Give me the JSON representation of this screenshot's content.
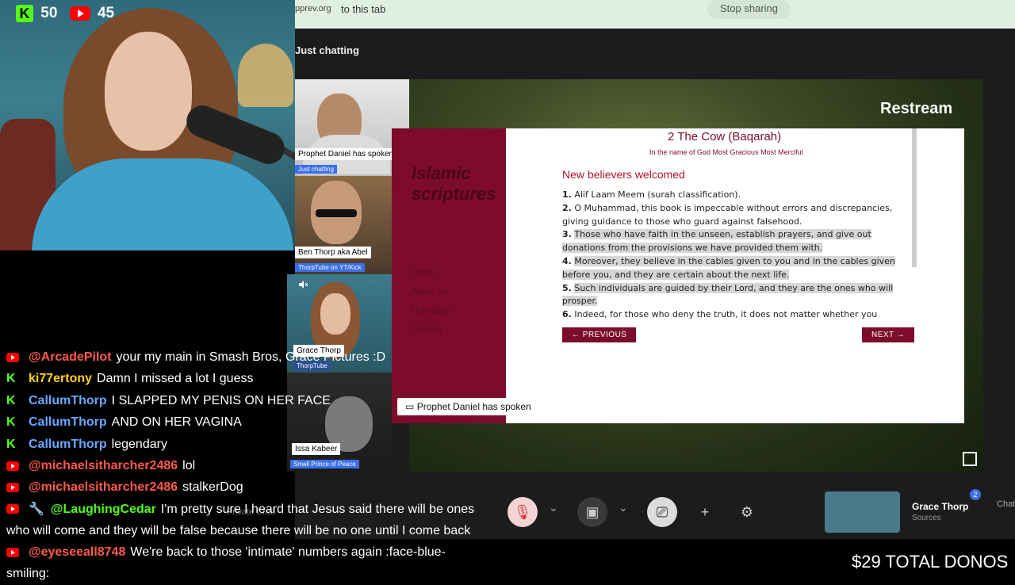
{
  "stats": {
    "kick_viewers": "50",
    "youtube_viewers": "45"
  },
  "share_bar": {
    "url_fragment": "pprev.org",
    "tab_text": "to this tab",
    "stop_label": "Stop sharing"
  },
  "studio": {
    "title": "Just chatting",
    "watermark": "Restream",
    "caption": "Prophet Daniel has spoken"
  },
  "participants": [
    {
      "name": "Prophet Daniel has spoken",
      "sub": "Just chatting"
    },
    {
      "name": "Ben Thorp aka Abel",
      "sub": "ThorpTube on YT/Kick"
    },
    {
      "name": "Grace Thorp",
      "sub": "ThorpTube"
    },
    {
      "name": "Issa Kabeer",
      "sub": "Small Prince of Peace"
    }
  ],
  "slide": {
    "brand": "Islamic scriptures",
    "nav": [
      "Home",
      "About Us",
      "Holy Bible",
      "Contact"
    ],
    "chapter_title": "2 The Cow (Baqarah)",
    "subtitle": "In the name of God Most Gracious Most Merciful",
    "heading": "New believers welcomed",
    "verses": [
      {
        "num": "1.",
        "text": "Alif Laam Meem (surah classification)."
      },
      {
        "num": "2.",
        "text": "O Muhammad, this book is impeccable without errors and discrepancies, giving guidance to those who guard against falsehood."
      },
      {
        "num": "3.",
        "text": "Those who have faith in the unseen, establish prayers, and give out donations from the provisions we have provided them with."
      },
      {
        "num": "4.",
        "text": "Moreover, they believe in the cables given to you and in the cables given before you, and they are certain about the next life."
      },
      {
        "num": "5.",
        "text": "Such individuals are guided by their Lord, and they are the ones who will prosper."
      },
      {
        "num": "6.",
        "text": "Indeed, for those who deny the truth, it does not matter whether you"
      }
    ],
    "prev_label": "← PREVIOUS",
    "next_label": "NEXT →"
  },
  "toolbar": {
    "private_chat": "Private Chat",
    "profile_name": "Grace Thorp",
    "profile_sub": "Sources",
    "badge_count": "2",
    "chat_label": "Chat"
  },
  "chat": [
    {
      "platform": "youtube",
      "user": "@ArcadePilot",
      "color": "red",
      "text": "your my main in Smash Bros, Grace Pictures :D"
    },
    {
      "platform": "kick",
      "user": "ki77ertony",
      "color": "yellow",
      "text": "Damn I missed a lot I guess"
    },
    {
      "platform": "kick",
      "user": "CallumThorp",
      "color": "blue",
      "text": "I SLAPPED MY PENIS ON HER FACE"
    },
    {
      "platform": "kick",
      "user": "CallumThorp",
      "color": "blue",
      "text": "AND ON HER VAGINA"
    },
    {
      "platform": "kick",
      "user": "CallumThorp",
      "color": "blue",
      "text": "legendary"
    },
    {
      "platform": "youtube",
      "user": "@michaelsitharcher2486",
      "color": "red",
      "text": "lol"
    },
    {
      "platform": "youtube",
      "user": "@michaelsitharcher2486",
      "color": "red",
      "text": "stalkerDog"
    },
    {
      "platform": "youtube",
      "user": "@LaughingCedar",
      "color": "green",
      "text": "I'm pretty sure I heard that Jesus said there will be ones",
      "text2": "who will come and they will be false because there will be no one until I come back"
    },
    {
      "platform": "youtube",
      "user": "@eyeseeall8748",
      "color": "red",
      "text": "We're back to those 'intimate' numbers again :face-blue-",
      "text2": "smiling:"
    }
  ],
  "donos": "$29 TOTAL DONOS"
}
